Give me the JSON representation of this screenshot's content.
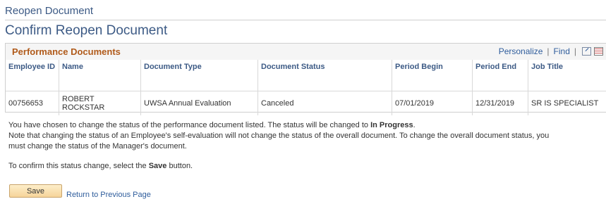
{
  "breadcrumb": "Reopen Document",
  "page_title": "Confirm Reopen Document",
  "grid": {
    "title": "Performance Documents",
    "tools": {
      "personalize": "Personalize",
      "sep1": "|",
      "find": "Find",
      "sep2": "|",
      "icons": [
        "view-all-icon",
        "download-icon"
      ]
    },
    "columns": [
      "Employee ID",
      "Name",
      "Document Type",
      "Document Status",
      "Period Begin",
      "Period End",
      "Job Title"
    ],
    "rows": [
      [
        "00756653",
        "ROBERT ROCKSTAR",
        "UWSA Annual Evaluation",
        "Canceled",
        "07/01/2019",
        "12/31/2019",
        "SR IS SPECIALIST"
      ]
    ]
  },
  "message": {
    "line1_pre": "You have chosen to change the status of the performance document listed. The status will be changed to ",
    "line1_bold": "In Progress",
    "line1_post": ".",
    "line2": "Note that changing the status of an Employee's self-evaluation will not change the status of the overall document. To change the overall document status, you must change the status of the Manager's document.",
    "confirm_pre": "To confirm this status change, select the ",
    "confirm_bold": "Save",
    "confirm_post": " button."
  },
  "actions": {
    "save_label": "Save",
    "return_label": "Return to Previous Page"
  }
}
